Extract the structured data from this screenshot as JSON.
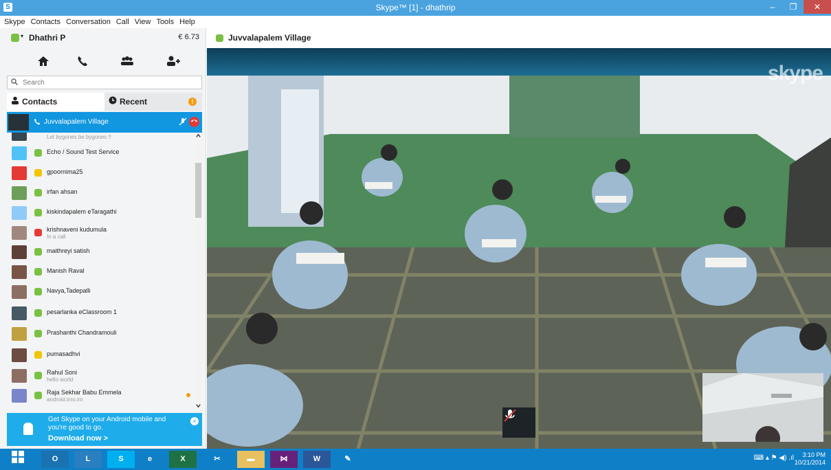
{
  "window": {
    "app_icon": "S",
    "title": "Skype™ [1] - dhathrip",
    "minimize": "–",
    "maximize": "❐",
    "close": "✕"
  },
  "menu": [
    "Skype",
    "Contacts",
    "Conversation",
    "Call",
    "View",
    "Tools",
    "Help"
  ],
  "profile": {
    "name": "Dhathri P",
    "credit": "€ 6.73",
    "dropdown": "▾"
  },
  "nav_icons": [
    "home-icon",
    "call-icon",
    "contacts-group-icon",
    "add-contact-icon"
  ],
  "search": {
    "placeholder": "Search",
    "icon": "🔍"
  },
  "tabs": {
    "contacts": "Contacts",
    "recent": "Recent",
    "alert": "!"
  },
  "active_call": {
    "name": "Juvvalapalem Village"
  },
  "contacts": [
    {
      "name": "",
      "mood": "Let bygones be bygones !!",
      "status": "online",
      "avatar": "#37474f"
    },
    {
      "name": "Echo / Sound Test Service",
      "mood": "",
      "status": "online",
      "avatar": "#4fc3f7"
    },
    {
      "name": "gpoornima25",
      "mood": "",
      "status": "away",
      "avatar": "#e53935"
    },
    {
      "name": "irfan ahsan",
      "mood": "",
      "status": "online",
      "avatar": "#6d9f5a"
    },
    {
      "name": "kiskindapalem eTaragathi",
      "mood": "",
      "status": "online",
      "avatar": "#90caf9"
    },
    {
      "name": "krishnaveni kudumula",
      "mood": "In a call",
      "status": "busy",
      "avatar": "#a1887f"
    },
    {
      "name": "maithreyi satish",
      "mood": "",
      "status": "online",
      "avatar": "#5d4037"
    },
    {
      "name": "Manish Raval",
      "mood": "",
      "status": "online",
      "avatar": "#795548"
    },
    {
      "name": "Navya,Tadepalli",
      "mood": "",
      "status": "online",
      "avatar": "#8d6e63"
    },
    {
      "name": "pesarlanka eClassroom 1",
      "mood": "",
      "status": "online",
      "avatar": "#455a64"
    },
    {
      "name": "Prashanthi Chandramouli",
      "mood": "",
      "status": "online",
      "avatar": "#c0a040"
    },
    {
      "name": "pumasadhvi",
      "mood": "",
      "status": "away",
      "avatar": "#6d4c41"
    },
    {
      "name": "Rahul Soni",
      "mood": "hello world",
      "status": "online",
      "avatar": "#8d6e63"
    },
    {
      "name": "Raja Sekhar Babu Emmela",
      "mood": "android.imo.im",
      "status": "online",
      "avatar": "#7986cb"
    }
  ],
  "promo": {
    "text": "Get Skype on your Android mobile and you're good to go.",
    "link": "Download now >",
    "close": "×"
  },
  "conversation": {
    "title": "Juvvalapalem Village",
    "logo": "skype",
    "mic": "🎤"
  },
  "colors": {
    "accent": "#00aff0",
    "online": "#7ac143",
    "away": "#f2c500",
    "busy": "#e53935",
    "taskbar": "#0f80c8"
  },
  "taskbar": {
    "apps": [
      "start-icon",
      "outlook-icon",
      "lync-icon",
      "skype-icon",
      "ie-icon",
      "excel-icon",
      "snipping-icon",
      "explorer-icon",
      "visual-studio-icon",
      "word-icon",
      "paint-icon"
    ],
    "time": "3:10 PM",
    "date": "10/21/2014"
  }
}
